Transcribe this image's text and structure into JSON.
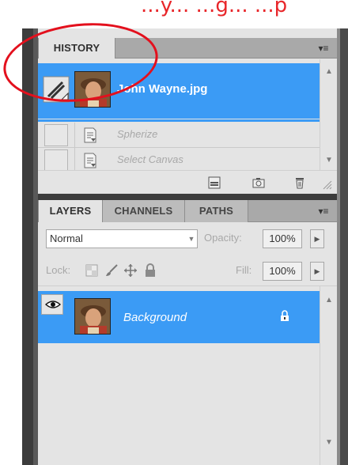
{
  "caption": "...y... ...g... ...p",
  "history_panel": {
    "tab_label": "HISTORY",
    "menu_icon": "panel-menu-icon",
    "snapshot": {
      "label": "John Wayne.jpg"
    },
    "steps": [
      {
        "label": "Spherize"
      },
      {
        "label": "Select Canvas"
      }
    ],
    "footer_icons": [
      "new-document-icon",
      "camera-icon",
      "trash-icon"
    ]
  },
  "layers_panel": {
    "tabs": [
      {
        "label": "LAYERS"
      },
      {
        "label": "CHANNELS"
      },
      {
        "label": "PATHS"
      }
    ],
    "blend_mode": "Normal",
    "opacity_label": "Opacity:",
    "opacity_value": "100%",
    "lock_label": "Lock:",
    "fill_label": "Fill:",
    "fill_value": "100%",
    "layers": [
      {
        "name": "Background",
        "visible": true,
        "locked": true
      }
    ]
  },
  "colors": {
    "selection": "#3b9bf5",
    "annotation": "#e3101d"
  }
}
